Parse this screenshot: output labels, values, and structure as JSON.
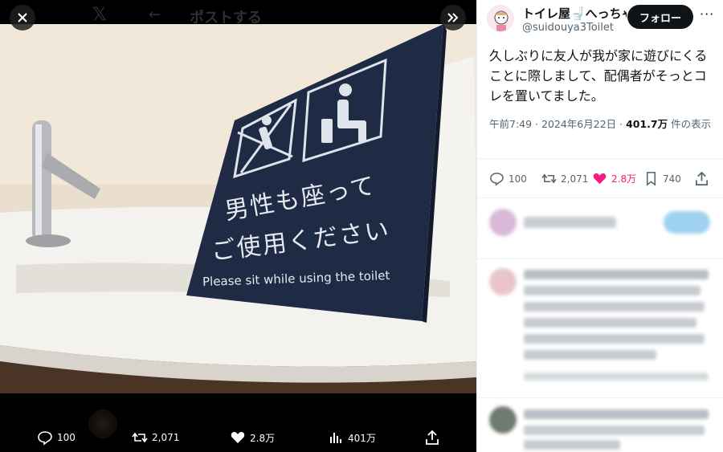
{
  "viewer": {
    "ghost_title": "ポストする",
    "actions": {
      "reply_count": "100",
      "retweet_count": "2,071",
      "like_count": "2.8万",
      "view_count": "401万"
    },
    "photo_sign": {
      "line1": "男性も座って",
      "line2": "ご使用ください",
      "line3": "Please sit while using the toilet"
    }
  },
  "post": {
    "author_name": "トイレ屋🚽へっちゃ",
    "author_handle": "@suidouya3Toilet",
    "follow_label": "フォロー",
    "more_label": "···",
    "text": "久しぶりに友人が我が家に遊びにくることに際しまして、配偶者がそっとコレを置いてました。",
    "time": "午前7:49 · 2024年6月22日 · ",
    "views_value": "401.7万",
    "views_label": " 件の表示",
    "reply_count": "100",
    "retweet_count": "2,071",
    "like_count": "2.8万",
    "bookmark_count": "740"
  },
  "colors": {
    "like_pink": "#f91880",
    "sign_navy": "#1f2a44",
    "text_primary": "#0f1419",
    "text_secondary": "#536471"
  },
  "icons": [
    "close-icon",
    "expand-icon",
    "reply-icon",
    "retweet-icon",
    "like-icon",
    "views-icon",
    "share-icon",
    "bookmark-icon"
  ]
}
